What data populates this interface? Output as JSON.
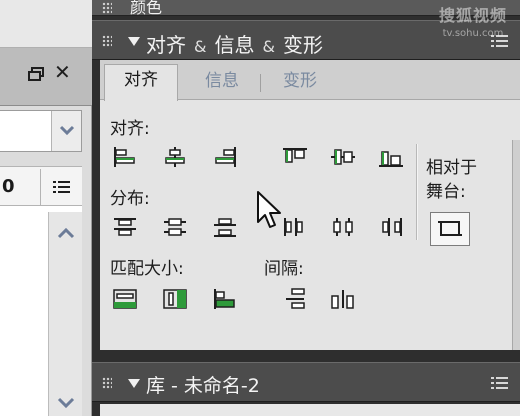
{
  "left_panel": {
    "number_value": "0"
  },
  "color_panel": {
    "title": "颜色"
  },
  "align_panel": {
    "title_parts": [
      "对齐",
      "&",
      "信息",
      "&",
      "变形"
    ],
    "tabs": [
      {
        "label": "对齐",
        "active": true
      },
      {
        "label": "信息",
        "active": false
      },
      {
        "label": "变形",
        "active": false
      }
    ],
    "section_align": "对齐:",
    "section_distribute": "分布:",
    "section_match_size": "匹配大小:",
    "section_space": "间隔:",
    "relative_to_stage_line1": "相对于",
    "relative_to_stage_line2": "舞台:"
  },
  "library_panel": {
    "title": "库 - 未命名-2"
  },
  "watermark": {
    "main": "搜狐视频",
    "url": "tv.sohu.com"
  },
  "icons": {
    "restore": "restore-window-icon",
    "close": "close-icon",
    "dropdown": "chevron-down-icon",
    "options": "panel-options-menu-icon",
    "scroll_up": "scroll-up-icon",
    "scroll_down": "scroll-down-icon",
    "cursor": "mouse-pointer-icon"
  },
  "colors": {
    "panel_header_bg": "#4c4c4c",
    "panel_body_bg": "#e4e4e4",
    "inactive_tab_text": "#7a8aa0",
    "icon_stroke": "#1e1e1e",
    "icon_fill": "#2e9a3a"
  }
}
